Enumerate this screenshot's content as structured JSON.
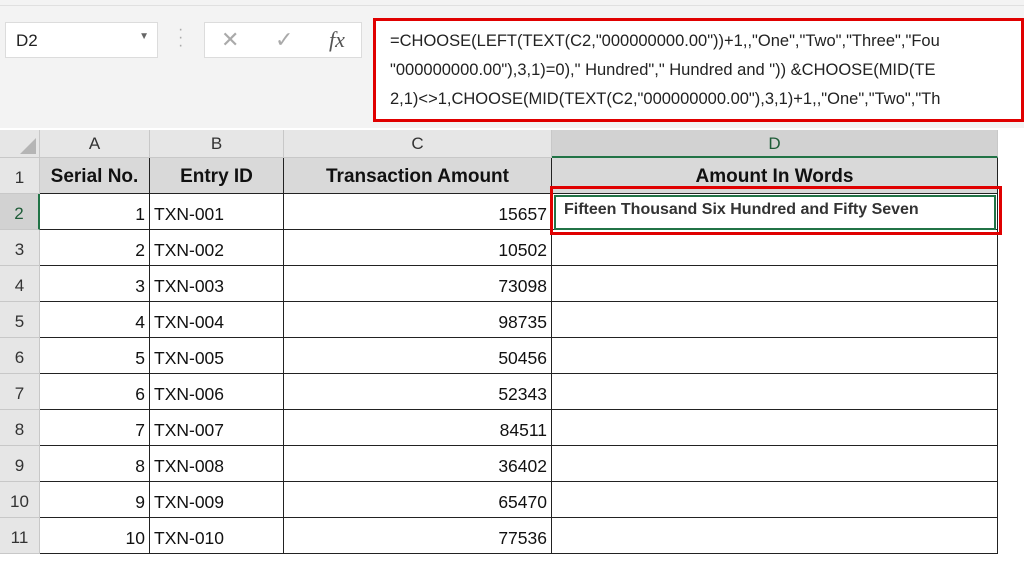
{
  "name_box": "D2",
  "formula_icons": [
    "cancel-icon",
    "enter-icon",
    "fx-icon"
  ],
  "fx_label": "fx",
  "formula_lines": [
    "=CHOOSE(LEFT(TEXT(C2,\"000000000.00\"))+1,,\"One\",\"Two\",\"Three\",\"Fou",
    "\"000000000.00\"),3,1)=0),\" Hundred\",\" Hundred and \")) &CHOOSE(MID(TE",
    "2,1)<>1,CHOOSE(MID(TEXT(C2,\"000000000.00\"),3,1)+1,,\"One\",\"Two\",\"Th"
  ],
  "columns": [
    "A",
    "B",
    "C",
    "D"
  ],
  "headers": [
    "Serial No.",
    "Entry ID",
    "Transaction Amount",
    "Amount In Words"
  ],
  "rows": [
    {
      "n": "1",
      "id": "TXN-001",
      "amt": "15657",
      "words": "Fifteen Thousand Six Hundred and Fifty Seven"
    },
    {
      "n": "2",
      "id": "TXN-002",
      "amt": "10502",
      "words": ""
    },
    {
      "n": "3",
      "id": "TXN-003",
      "amt": "73098",
      "words": ""
    },
    {
      "n": "4",
      "id": "TXN-004",
      "amt": "98735",
      "words": ""
    },
    {
      "n": "5",
      "id": "TXN-005",
      "amt": "50456",
      "words": ""
    },
    {
      "n": "6",
      "id": "TXN-006",
      "amt": "52343",
      "words": ""
    },
    {
      "n": "7",
      "id": "TXN-007",
      "amt": "84511",
      "words": ""
    },
    {
      "n": "8",
      "id": "TXN-008",
      "amt": "36402",
      "words": ""
    },
    {
      "n": "9",
      "id": "TXN-009",
      "amt": "65470",
      "words": ""
    },
    {
      "n": "10",
      "id": "TXN-010",
      "amt": "77536",
      "words": ""
    }
  ],
  "row_numbers": [
    "1",
    "2",
    "3",
    "4",
    "5",
    "6",
    "7",
    "8",
    "9",
    "10",
    "11"
  ]
}
